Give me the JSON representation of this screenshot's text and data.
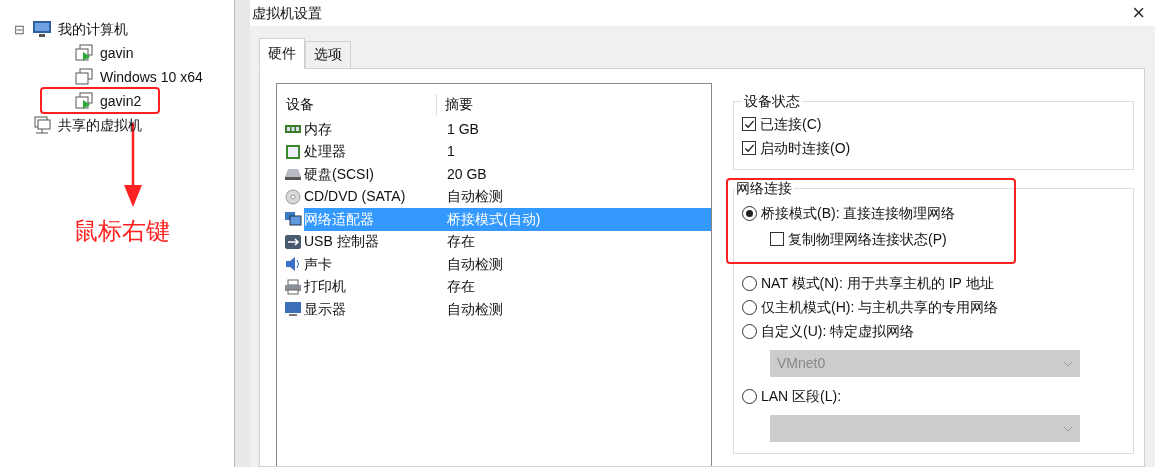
{
  "library": {
    "tree": [
      {
        "label": "我的计算机",
        "kind": "computer",
        "expanded": true,
        "toggle": "⊟",
        "children": [
          {
            "label": "gavin",
            "kind": "vm",
            "running": true,
            "highlighted": false
          },
          {
            "label": "Windows 10 x64",
            "kind": "vm",
            "running": false,
            "highlighted": false
          },
          {
            "label": "gavin2",
            "kind": "vm",
            "running": true,
            "highlighted": true
          }
        ]
      },
      {
        "label": "共享的虚拟机",
        "kind": "shared"
      }
    ],
    "annotation": "鼠标右键"
  },
  "dialog": {
    "title": "虚拟机设置",
    "close": "×",
    "tabs": [
      {
        "label": "硬件",
        "selected": true
      },
      {
        "label": "选项",
        "selected": false
      }
    ],
    "devices": {
      "columns": [
        "设备",
        "摘要"
      ],
      "rows": [
        {
          "kind": "memory",
          "device": "内存",
          "summary": "1 GB",
          "selected": false
        },
        {
          "kind": "cpu",
          "device": "处理器",
          "summary": "1",
          "selected": false
        },
        {
          "kind": "disk",
          "device": "硬盘(SCSI)",
          "summary": "20 GB",
          "selected": false
        },
        {
          "kind": "cd",
          "device": "CD/DVD (SATA)",
          "summary": "自动检测",
          "selected": false
        },
        {
          "kind": "network",
          "device": "网络适配器",
          "summary": "桥接模式(自动)",
          "selected": true
        },
        {
          "kind": "usb",
          "device": "USB 控制器",
          "summary": "存在",
          "selected": false
        },
        {
          "kind": "sound",
          "device": "声卡",
          "summary": "自动检测",
          "selected": false
        },
        {
          "kind": "printer",
          "device": "打印机",
          "summary": "存在",
          "selected": false
        },
        {
          "kind": "display",
          "device": "显示器",
          "summary": "自动检测",
          "selected": false
        }
      ]
    },
    "device_status": {
      "title": "设备状态",
      "options": [
        {
          "label": "已连接(C)",
          "checked": true
        },
        {
          "label": "启动时连接(O)",
          "checked": true
        }
      ]
    },
    "network": {
      "title": "网络连接",
      "highlighted": true,
      "options": [
        {
          "kind": "radio",
          "label": "桥接模式(B): 直接连接物理网络",
          "selected": true
        },
        {
          "kind": "checkbox",
          "label": "复制物理网络连接状态(P)",
          "checked": false
        },
        {
          "kind": "radio",
          "label": "NAT 模式(N): 用于共享主机的 IP 地址",
          "selected": false
        },
        {
          "kind": "radio",
          "label": "仅主机模式(H): 与主机共享的专用网络",
          "selected": false
        },
        {
          "kind": "radio",
          "label": "自定义(U): 特定虚拟网络",
          "selected": false
        },
        {
          "kind": "select",
          "value": "VMnet0",
          "disabled": true
        },
        {
          "kind": "radio",
          "label": "LAN 区段(L):",
          "selected": false
        },
        {
          "kind": "select",
          "disabled": true
        }
      ]
    }
  }
}
